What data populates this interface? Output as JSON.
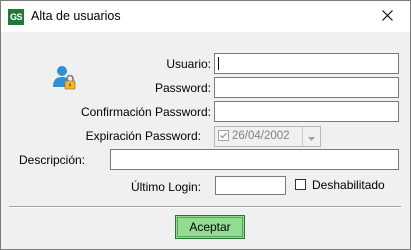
{
  "window": {
    "app_icon_text": "GS",
    "title": "Alta de usuarios",
    "close_glyph": "✕"
  },
  "icons": {
    "user": "user-lock-icon",
    "close": "close-icon"
  },
  "form": {
    "usuario": {
      "label": "Usuario:",
      "value": ""
    },
    "password": {
      "label": "Password:",
      "value": ""
    },
    "confirmacion": {
      "label": "Confirmación Password:",
      "value": ""
    },
    "expiracion": {
      "label": "Expiración Password:",
      "value": "26/04/2002",
      "checked": true,
      "enabled": false
    },
    "descripcion": {
      "label": "Descripción:",
      "value": ""
    },
    "ultimo_login": {
      "label": "Último Login:",
      "value": ""
    },
    "deshabilitado": {
      "label": "Deshabilitado",
      "checked": false
    }
  },
  "buttons": {
    "aceptar": "Aceptar"
  },
  "colors": {
    "accept_button": "#93dd93",
    "app_icon": "#1e7a34",
    "user_icon_person": "#2e8fd6",
    "user_icon_lock": "#f2b632"
  }
}
